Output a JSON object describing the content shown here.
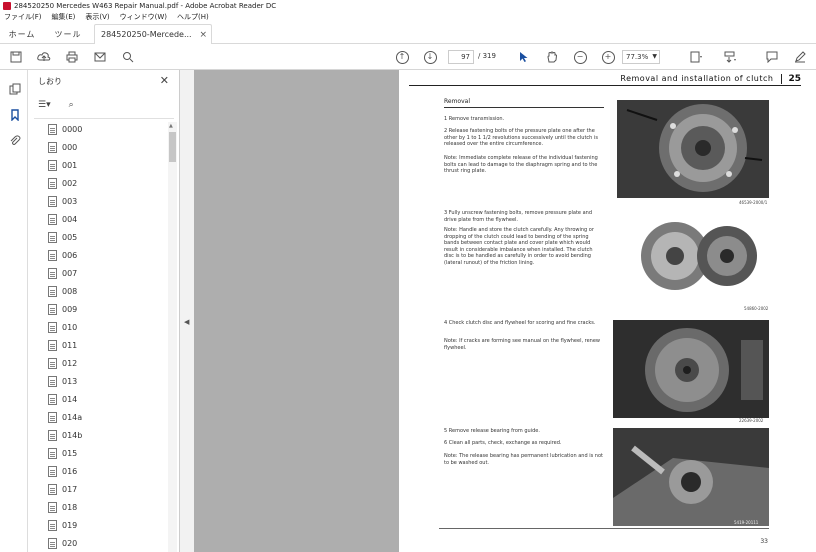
{
  "window": {
    "title": "284520250 Mercedes W463 Repair Manual.pdf - Adobe Acrobat Reader DC"
  },
  "menu": [
    "ファイル(F)",
    "編集(E)",
    "表示(V)",
    "ウィンドウ(W)",
    "ヘルプ(H)"
  ],
  "tabs": {
    "home": "ホーム",
    "tools": "ツール",
    "document": "284520250-Mercede..."
  },
  "toolbar": {
    "page_current": "97",
    "page_total": "/ 319",
    "zoom": "77.3%"
  },
  "bookmarks": {
    "header": "しおり",
    "items": [
      "0000",
      "000",
      "001",
      "002",
      "003",
      "004",
      "005",
      "006",
      "007",
      "008",
      "009",
      "010",
      "011",
      "012",
      "013",
      "014",
      "014a",
      "014b",
      "015",
      "016",
      "017",
      "018",
      "019",
      "020"
    ]
  },
  "page": {
    "header_title": "Removal and installation of clutch",
    "header_number": "25",
    "section": "Removal",
    "step1": "1  Remove transmission.",
    "step2": "2  Release fastening bolts of the pressure plate one after the other by 1 to 1 1/2 revolutions successively until the clutch is released over the entire circumference.",
    "note1": "Note: Immediate complete release of the individual fastening bolts can lead to damage to the diaphragm spring and to the thrust ring plate.",
    "cap1": "46539-2000/1",
    "step3": "3  Fully unscrew fastening bolts, remove pressure plate and drive plate from the flywheel.",
    "note2": "Note: Handle and store the clutch carefully. Any throwing or dropping of the clutch could lead to bending of the spring bands between contact plate and cover plate which would result in considerable imbalance when installed. The clutch disc is to be handled as carefully in order to avoid bending (lateral runout) of the friction lining.",
    "cap2": "54860-2002",
    "step4": "4  Check clutch disc and flywheel for scoring and fine cracks.",
    "note3": "Note: If cracks are forming see manual on the flywheel, renew flywheel.",
    "cap3": "22639-2002",
    "step5": "5  Remove release bearing from guide.",
    "step6": "6  Clean all parts, check, exchange as required.",
    "note4": "Note: The release bearing has permanent lubrication and is not to be washed out.",
    "cap4": "5419-20111",
    "footer_number": "33"
  },
  "colors": {
    "accent_red": "#c8102e",
    "canvas": "#aeaeae",
    "page": "#ffffff"
  }
}
